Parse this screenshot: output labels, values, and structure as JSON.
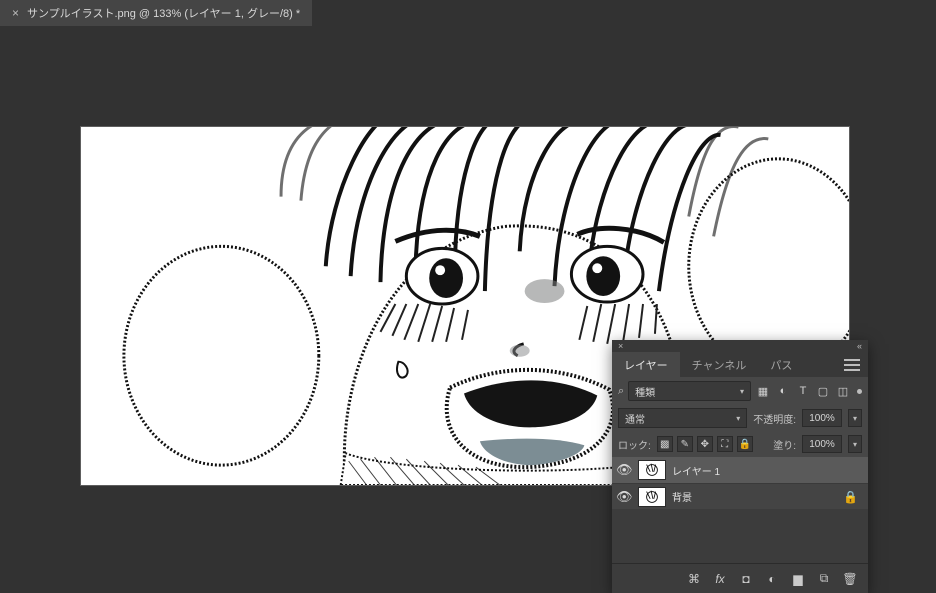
{
  "tab": {
    "close": "×",
    "title": "サンプルイラスト.png @ 133% (レイヤー 1, グレー/8) *"
  },
  "panel": {
    "close": "×",
    "collapse": "«",
    "tabs": {
      "layers": "レイヤー",
      "channels": "チャンネル",
      "paths": "パス"
    },
    "kind": {
      "search": "⌕",
      "label": "種類"
    },
    "blend": {
      "mode": "通常",
      "opacity_label": "不透明度:",
      "opacity_value": "100%"
    },
    "lock": {
      "label": "ロック:",
      "fill_label": "塗り:",
      "fill_value": "100%"
    },
    "layers": [
      {
        "name": "レイヤー 1",
        "selected": true,
        "locked": false
      },
      {
        "name": "背景",
        "selected": false,
        "locked": true
      }
    ]
  }
}
